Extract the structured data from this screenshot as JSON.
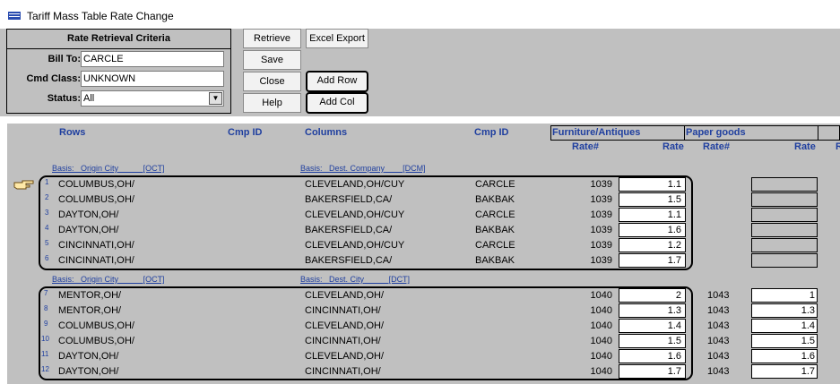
{
  "window": {
    "title": "Tariff Mass Table Rate Change"
  },
  "criteria": {
    "title": "Rate Retrieval Criteria",
    "bill_to_label": "Bill To:",
    "bill_to_value": "CARCLE",
    "cmd_class_label": "Cmd Class:",
    "cmd_class_value": "UNKNOWN",
    "status_label": "Status:",
    "status_value": "All"
  },
  "buttons": {
    "retrieve": "Retrieve",
    "save": "Save",
    "close": "Close",
    "help": "Help",
    "excel_export": "Excel Export",
    "add_row": "Add Row",
    "add_col": "Add Col"
  },
  "grid": {
    "headers": {
      "rows": "Rows",
      "cmp_id_1": "Cmp ID",
      "columns": "Columns",
      "cmp_id_2": "Cmp ID",
      "col_groups": [
        "Furniture/Antiques",
        "Paper goods"
      ],
      "rate_num": "Rate#",
      "rate": "Rate",
      "rate_num_2": "Rate#",
      "rate_2": "Rate",
      "extra": "R"
    },
    "groups": [
      {
        "basis_row": {
          "label": "Basis:",
          "field": "Origin City",
          "code": "[OCT]"
        },
        "basis_col": {
          "label": "Basis:",
          "field": "Dest. Company",
          "code": "[DCM]"
        },
        "rows": [
          {
            "n": "1",
            "origin": "COLUMBUS,OH/",
            "dest": "CLEVELAND,OH/CUY",
            "cmp": "CARCLE",
            "rate_no": "1039",
            "rate": "1.1"
          },
          {
            "n": "2",
            "origin": "COLUMBUS,OH/",
            "dest": "BAKERSFIELD,CA/",
            "cmp": "BAKBAK",
            "rate_no": "1039",
            "rate": "1.5"
          },
          {
            "n": "3",
            "origin": "DAYTON,OH/",
            "dest": "CLEVELAND,OH/CUY",
            "cmp": "CARCLE",
            "rate_no": "1039",
            "rate": "1.1"
          },
          {
            "n": "4",
            "origin": "DAYTON,OH/",
            "dest": "BAKERSFIELD,CA/",
            "cmp": "BAKBAK",
            "rate_no": "1039",
            "rate": "1.6"
          },
          {
            "n": "5",
            "origin": "CINCINNATI,OH/",
            "dest": "CLEVELAND,OH/CUY",
            "cmp": "CARCLE",
            "rate_no": "1039",
            "rate": "1.2"
          },
          {
            "n": "6",
            "origin": "CINCINNATI,OH/",
            "dest": "BAKERSFIELD,CA/",
            "cmp": "BAKBAK",
            "rate_no": "1039",
            "rate": "1.7"
          }
        ]
      },
      {
        "basis_row": {
          "label": "Basis:",
          "field": "Origin City",
          "code": "[OCT]"
        },
        "basis_col": {
          "label": "Basis:",
          "field": "Dest. City",
          "code": "[DCT]"
        },
        "rows": [
          {
            "n": "7",
            "origin": "MENTOR,OH/",
            "dest": "CLEVELAND,OH/",
            "cmp": "",
            "rate_no": "1040",
            "rate": "2",
            "rate_no_2": "1043",
            "rate_2": "1"
          },
          {
            "n": "8",
            "origin": "MENTOR,OH/",
            "dest": "CINCINNATI,OH/",
            "cmp": "",
            "rate_no": "1040",
            "rate": "1.3",
            "rate_no_2": "1043",
            "rate_2": "1.3"
          },
          {
            "n": "9",
            "origin": "COLUMBUS,OH/",
            "dest": "CLEVELAND,OH/",
            "cmp": "",
            "rate_no": "1040",
            "rate": "1.4",
            "rate_no_2": "1043",
            "rate_2": "1.4"
          },
          {
            "n": "10",
            "origin": "COLUMBUS,OH/",
            "dest": "CINCINNATI,OH/",
            "cmp": "",
            "rate_no": "1040",
            "rate": "1.5",
            "rate_no_2": "1043",
            "rate_2": "1.5"
          },
          {
            "n": "11",
            "origin": "DAYTON,OH/",
            "dest": "CLEVELAND,OH/",
            "cmp": "",
            "rate_no": "1040",
            "rate": "1.6",
            "rate_no_2": "1043",
            "rate_2": "1.6"
          },
          {
            "n": "12",
            "origin": "DAYTON,OH/",
            "dest": "CINCINNATI,OH/",
            "cmp": "",
            "rate_no": "1040",
            "rate": "1.7",
            "rate_no_2": "1043",
            "rate_2": "1.7"
          }
        ]
      }
    ]
  },
  "colors": {
    "accent": "#1f3f9f",
    "panel": "#c0c0c0"
  },
  "icons": {
    "app": "app-icon",
    "pointer": "pointing-hand-icon",
    "dropdown": "chevron-down-icon"
  }
}
